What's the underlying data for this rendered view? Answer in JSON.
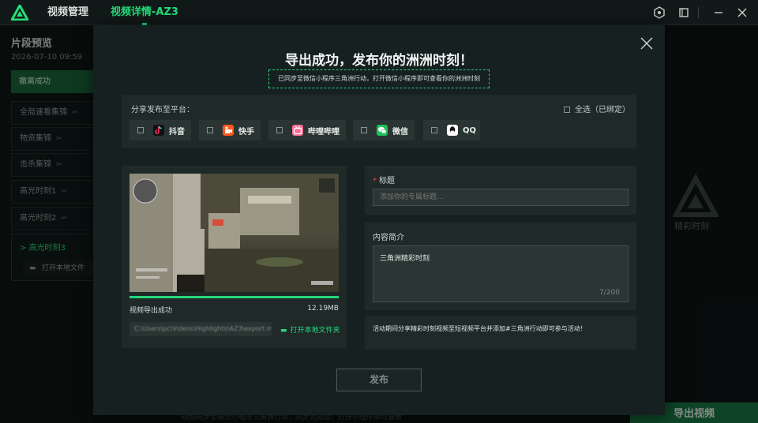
{
  "topbar": {
    "tab_manage": "视频管理",
    "tab_detail": "视频详情-AZ3",
    "icons": [
      "settings-icon",
      "window-icon",
      "minimize-icon",
      "close-icon"
    ]
  },
  "background": {
    "title": "片段预览",
    "date": "2026-07-10 09:59",
    "flag": "撤离成功",
    "items": [
      "全局速看集锦",
      "物资集锦",
      "击杀集锦",
      "高光时刻1",
      "高光时刻2"
    ],
    "expanded_item": "高光时刻3",
    "expanded_open": "打开本地文件",
    "watermark_text": "精彩时刻",
    "export_button": "导出视频",
    "bottom_text": "视频同步至微信小程序三角洲行动，同步完成后，打开小程序即可查看"
  },
  "modal": {
    "title": "导出成功，发布你的洲洲时刻！",
    "subtitle": "已同步至微信小程序三角洲行动，打开微信小程序即可查看你的洲洲时刻",
    "share_label": "分享发布至平台：",
    "select_all": "全选（已绑定）",
    "platforms": [
      {
        "name": "抖音",
        "color": "#111111"
      },
      {
        "name": "快手",
        "color": "#ff5a1f"
      },
      {
        "name": "哔哩哔哩",
        "color": "#fb7299"
      },
      {
        "name": "微信",
        "color": "#1fc15a"
      },
      {
        "name": "QQ",
        "color": "#ffffff"
      }
    ],
    "video": {
      "status": "视频导出成功",
      "size": "12.19MB",
      "progress": 1.0,
      "path": "C:\\Users\\pc\\Videos\\Highlights\\AZ3\\export.mp4",
      "open_folder": "打开本地文件夹"
    },
    "title_field": {
      "label": "标题",
      "placeholder": "添加你的专属标题..."
    },
    "intro_field": {
      "label": "内容简介",
      "value": "三角洲精彩时刻",
      "count": "7/200"
    },
    "tip": "活动期间分享精彩时刻视频至短视频平台并添加#三角洲行动即可参与活动！",
    "publish": "发布",
    "accent": "#22e07a"
  }
}
